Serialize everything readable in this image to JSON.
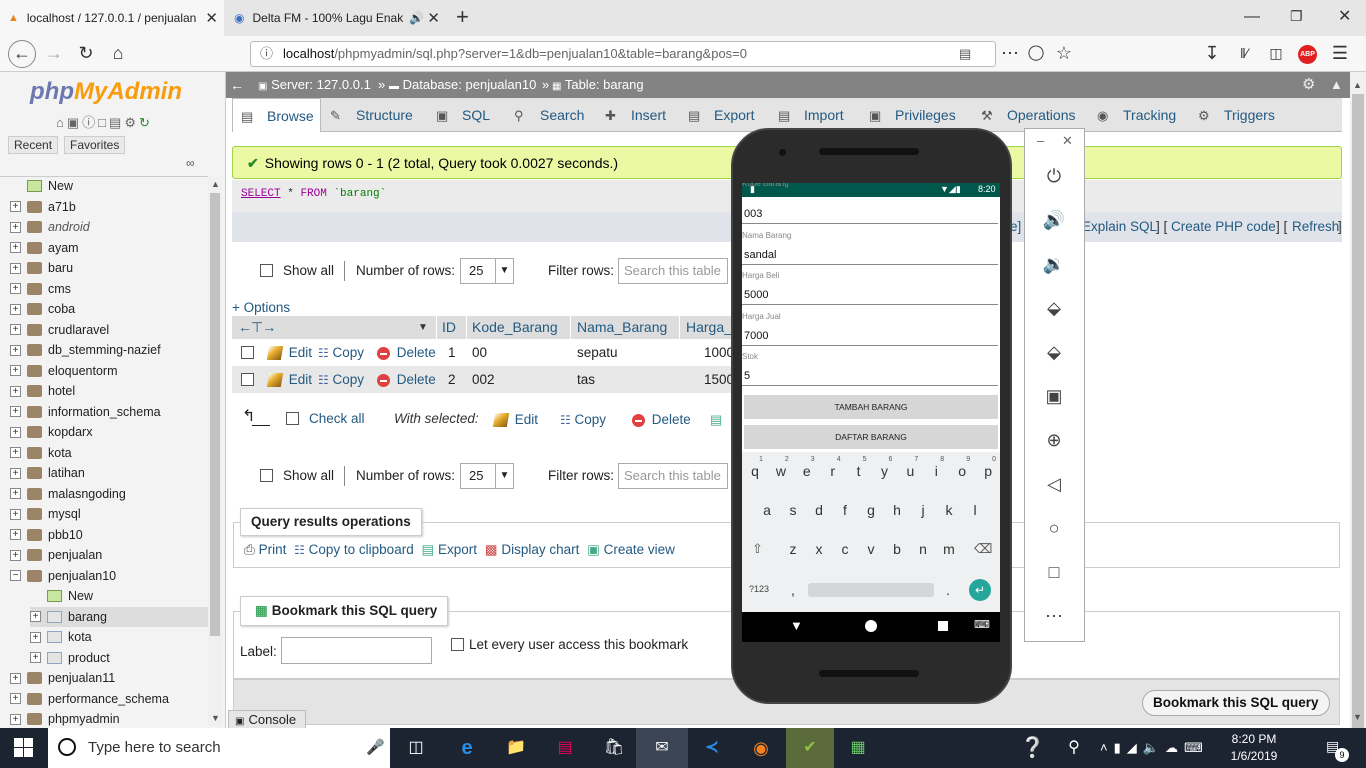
{
  "browser": {
    "tab1_title": "localhost / 127.0.0.1 / penjualan",
    "tab2_title": "Delta FM - 100% Lagu Enak",
    "new_tab": "+",
    "url_host": "localhost",
    "url_rest": "/phpmyadmin/sql.php?server=1&db=penjualan10&table=barang&pos=0",
    "abp_badge": "ABP"
  },
  "pma": {
    "logo_php": "php",
    "logo_myadmin": "MyAdmin",
    "recent": "Recent",
    "favorites": "Favorites",
    "tree": [
      {
        "label": "New",
        "kind": "new"
      },
      {
        "label": "a71b",
        "kind": "db"
      },
      {
        "label": "android",
        "kind": "db",
        "italic": true
      },
      {
        "label": "ayam",
        "kind": "db"
      },
      {
        "label": "baru",
        "kind": "db"
      },
      {
        "label": "cms",
        "kind": "db"
      },
      {
        "label": "coba",
        "kind": "db"
      },
      {
        "label": "crudlaravel",
        "kind": "db"
      },
      {
        "label": "db_stemming-nazief",
        "kind": "db"
      },
      {
        "label": "eloquentorm",
        "kind": "db"
      },
      {
        "label": "hotel",
        "kind": "db"
      },
      {
        "label": "information_schema",
        "kind": "db"
      },
      {
        "label": "kopdarx",
        "kind": "db"
      },
      {
        "label": "kota",
        "kind": "db"
      },
      {
        "label": "latihan",
        "kind": "db"
      },
      {
        "label": "malasngoding",
        "kind": "db"
      },
      {
        "label": "mysql",
        "kind": "db"
      },
      {
        "label": "pbb10",
        "kind": "db"
      },
      {
        "label": "penjualan",
        "kind": "db"
      },
      {
        "label": "penjualan10",
        "kind": "db-open"
      },
      {
        "label": "New",
        "kind": "new-sub"
      },
      {
        "label": "barang",
        "kind": "table",
        "selected": true
      },
      {
        "label": "kota",
        "kind": "table"
      },
      {
        "label": "product",
        "kind": "table"
      },
      {
        "label": "penjualan11",
        "kind": "db"
      },
      {
        "label": "performance_schema",
        "kind": "db"
      },
      {
        "label": "phpmyadmin",
        "kind": "db"
      }
    ],
    "breadcrumb": {
      "server": "Server: 127.0.0.1",
      "database": "Database: penjualan10",
      "table": "Table: barang"
    },
    "tabs": [
      "Browse",
      "Structure",
      "SQL",
      "Search",
      "Insert",
      "Export",
      "Import",
      "Privileges",
      "Operations",
      "Tracking",
      "Triggers"
    ],
    "success_msg": "Showing rows 0 - 1 (2 total, Query took 0.0027 seconds.)",
    "sql": {
      "select": "SELECT",
      "star": "*",
      "from": "FROM",
      "table": "`barang`"
    },
    "sql_links": {
      "edit_tail": "e]",
      "explain": "Explain SQL",
      "php": "Create PHP code",
      "refresh": "Refresh"
    },
    "show_all": "Show all",
    "num_rows_label": "Number of rows:",
    "num_rows_value": "25",
    "filter_label": "Filter rows:",
    "filter_placeholder": "Search this table",
    "options": "+ Options",
    "columns": [
      "ID",
      "Kode_Barang",
      "Nama_Barang",
      "Harga_"
    ],
    "rows": [
      {
        "id": "1",
        "kode": "00",
        "nama": "sepatu",
        "harga": "1000"
      },
      {
        "id": "2",
        "kode": "002",
        "nama": "tas",
        "harga": "1500"
      }
    ],
    "row_actions": {
      "edit": "Edit",
      "copy": "Copy",
      "delete": "Delete"
    },
    "check_all": "Check all",
    "with_selected": "With selected:",
    "qro_title": "Query results operations",
    "qro": [
      "Print",
      "Copy to clipboard",
      "Export",
      "Display chart",
      "Create view"
    ],
    "bookmark_title": "Bookmark this SQL query",
    "label_label": "Label:",
    "let_every_user": "Let every user access this bookmark",
    "bookmark_btn": "Bookmark this SQL query",
    "console": "Console"
  },
  "phone": {
    "time": "8:20",
    "fields": [
      {
        "label": "Kode Barang",
        "value": "003"
      },
      {
        "label": "Nama Barang",
        "value": "sandal"
      },
      {
        "label": "Harga Beli",
        "value": "5000"
      },
      {
        "label": "Harga Jual",
        "value": "7000"
      },
      {
        "label": "Stok",
        "value": "5"
      }
    ],
    "btn_tambah": "TAMBAH BARANG",
    "btn_daftar": "DAFTAR BARANG",
    "kb_row1": [
      "q",
      "w",
      "e",
      "r",
      "t",
      "y",
      "u",
      "i",
      "o",
      "p"
    ],
    "kb_nums": [
      "1",
      "2",
      "3",
      "4",
      "5",
      "6",
      "7",
      "8",
      "9",
      "0"
    ],
    "kb_row2": [
      "a",
      "s",
      "d",
      "f",
      "g",
      "h",
      "j",
      "k",
      "l"
    ],
    "kb_row3": [
      "z",
      "x",
      "c",
      "v",
      "b",
      "n",
      "m"
    ],
    "kb_sym": "?123",
    "kb_comma": ",",
    "kb_dot": "."
  },
  "taskbar": {
    "search_placeholder": "Type here to search",
    "time": "8:20 PM",
    "date": "1/6/2019",
    "notif_count": "9"
  }
}
